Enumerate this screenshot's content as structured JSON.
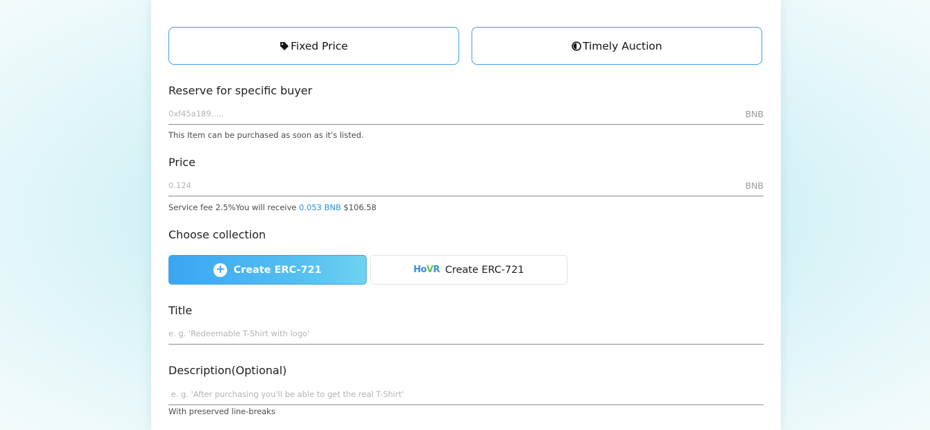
{
  "sale_type": {
    "fixed_label": "Fixed Price",
    "auction_label": "Timely Auction"
  },
  "reserve": {
    "label": "Reserve for specific buyer",
    "placeholder": "0xf45a189.....",
    "unit": "BNB",
    "hint": "This Item can be purchased as soon as it's listed."
  },
  "price": {
    "label": "Price",
    "placeholder": "0.124",
    "unit": "BNB",
    "fee_text": "Service fee 2.5%You will receive",
    "receive_amount": "0.053 BNB",
    "usd_value": "$106.58"
  },
  "collection": {
    "label": "Choose collection",
    "primary_label": "Create ERC-721",
    "secondary_label": "Create ERC-721",
    "logo_text": "HovR"
  },
  "title": {
    "label": "Title",
    "placeholder": "e. g. 'Redeemable T-Shirt with logo'"
  },
  "description": {
    "label": "Description(Optional)",
    "placeholder": " e. g. 'After purchasing you'll be able to get the real T-Shirt'",
    "hint": "With preserved line-breaks"
  },
  "colors": {
    "accent": "#3a9ee6",
    "gradient_start": "#3aa6f2",
    "gradient_end": "#6fd2f0"
  },
  "icons": {
    "fixed_price": "tag-icon",
    "auction": "half-moon-icon",
    "add": "plus-circle-icon"
  }
}
